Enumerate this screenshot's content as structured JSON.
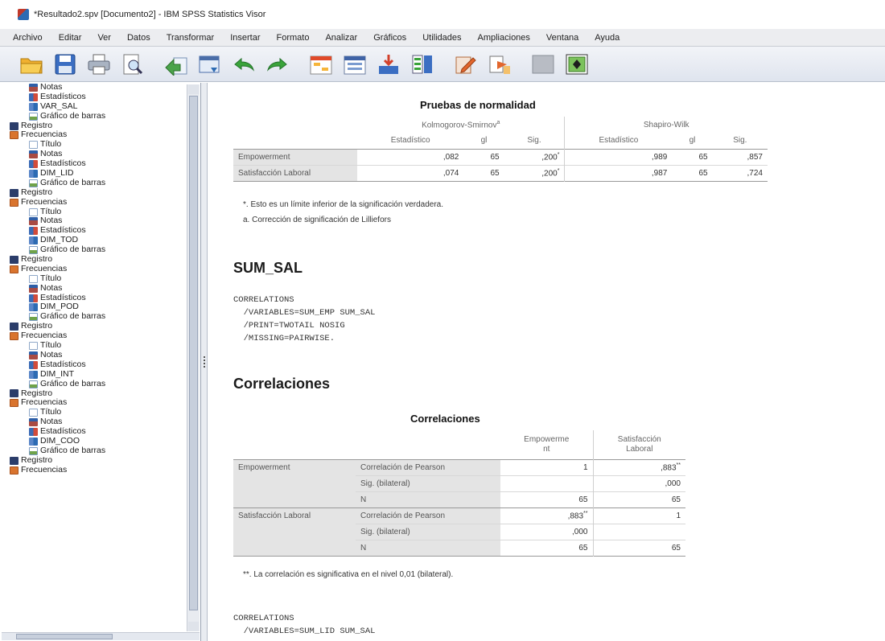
{
  "window": {
    "title": "*Resultado2.spv [Documento2] - IBM SPSS Statistics Visor"
  },
  "menu": [
    "Archivo",
    "Editar",
    "Ver",
    "Datos",
    "Transformar",
    "Insertar",
    "Formato",
    "Analizar",
    "Gráficos",
    "Utilidades",
    "Ampliaciones",
    "Ventana",
    "Ayuda"
  ],
  "toolbar": [
    "open-icon",
    "save-icon",
    "print-icon",
    "print-preview-icon",
    "export-icon",
    "recall-dialog-icon",
    "undo-icon",
    "redo-icon",
    "goto-data-icon",
    "goto-case-icon",
    "goto-variable-icon",
    "variables-icon",
    "show-all-icon",
    "hide-icon",
    "designated-window-icon",
    "insert-icon"
  ],
  "tree": [
    {
      "label": "Notas",
      "icon": "notes",
      "level": 1
    },
    {
      "label": "Estadísticos",
      "icon": "stats",
      "level": 1
    },
    {
      "label": "VAR_SAL",
      "icon": "var",
      "level": 1
    },
    {
      "label": "Gráfico de barras",
      "icon": "chart",
      "level": 1
    },
    {
      "label": "Registro",
      "icon": "log",
      "level": 0
    },
    {
      "label": "Frecuencias",
      "icon": "freq",
      "level": 0
    },
    {
      "label": "Título",
      "icon": "title",
      "level": 1
    },
    {
      "label": "Notas",
      "icon": "notes",
      "level": 1
    },
    {
      "label": "Estadísticos",
      "icon": "stats",
      "level": 1
    },
    {
      "label": "DIM_LID",
      "icon": "var",
      "level": 1
    },
    {
      "label": "Gráfico de barras",
      "icon": "chart",
      "level": 1
    },
    {
      "label": "Registro",
      "icon": "log",
      "level": 0
    },
    {
      "label": "Frecuencias",
      "icon": "freq",
      "level": 0
    },
    {
      "label": "Título",
      "icon": "title",
      "level": 1
    },
    {
      "label": "Notas",
      "icon": "notes",
      "level": 1
    },
    {
      "label": "Estadísticos",
      "icon": "stats",
      "level": 1
    },
    {
      "label": "DIM_TOD",
      "icon": "var",
      "level": 1
    },
    {
      "label": "Gráfico de barras",
      "icon": "chart",
      "level": 1
    },
    {
      "label": "Registro",
      "icon": "log",
      "level": 0
    },
    {
      "label": "Frecuencias",
      "icon": "freq",
      "level": 0
    },
    {
      "label": "Título",
      "icon": "title",
      "level": 1
    },
    {
      "label": "Notas",
      "icon": "notes",
      "level": 1
    },
    {
      "label": "Estadísticos",
      "icon": "stats",
      "level": 1
    },
    {
      "label": "DIM_POD",
      "icon": "var",
      "level": 1
    },
    {
      "label": "Gráfico de barras",
      "icon": "chart",
      "level": 1
    },
    {
      "label": "Registro",
      "icon": "log",
      "level": 0
    },
    {
      "label": "Frecuencias",
      "icon": "freq",
      "level": 0
    },
    {
      "label": "Título",
      "icon": "title",
      "level": 1
    },
    {
      "label": "Notas",
      "icon": "notes",
      "level": 1
    },
    {
      "label": "Estadísticos",
      "icon": "stats",
      "level": 1
    },
    {
      "label": "DIM_INT",
      "icon": "var",
      "level": 1
    },
    {
      "label": "Gráfico de barras",
      "icon": "chart",
      "level": 1
    },
    {
      "label": "Registro",
      "icon": "log",
      "level": 0
    },
    {
      "label": "Frecuencias",
      "icon": "freq",
      "level": 0
    },
    {
      "label": "Título",
      "icon": "title",
      "level": 1
    },
    {
      "label": "Notas",
      "icon": "notes",
      "level": 1
    },
    {
      "label": "Estadísticos",
      "icon": "stats",
      "level": 1
    },
    {
      "label": "DIM_COO",
      "icon": "var",
      "level": 1
    },
    {
      "label": "Gráfico de barras",
      "icon": "chart",
      "level": 1
    },
    {
      "label": "Registro",
      "icon": "log",
      "level": 0
    },
    {
      "label": "Frecuencias",
      "icon": "freq",
      "level": 0
    }
  ],
  "normality": {
    "title": "Pruebas de normalidad",
    "group_ks": "Kolmogorov-Smirnov",
    "group_ks_sup": "a",
    "group_sw": "Shapiro-Wilk",
    "cols": [
      "Estadístico",
      "gl",
      "Sig.",
      "Estadístico",
      "gl",
      "Sig."
    ],
    "rows": [
      {
        "label": "Empowerment",
        "ks_stat": ",082",
        "ks_gl": "65",
        "ks_sig": ",200",
        "ks_sig_sup": "*",
        "sw_stat": ",989",
        "sw_gl": "65",
        "sw_sig": ",857"
      },
      {
        "label": "Satisfacción Laboral",
        "ks_stat": ",074",
        "ks_gl": "65",
        "ks_sig": ",200",
        "ks_sig_sup": "*",
        "sw_stat": ",987",
        "sw_gl": "65",
        "sw_sig": ",724"
      }
    ],
    "footnotes": [
      "*. Esto es un límite inferior de la significación verdadera.",
      "a. Corrección de significación de Lilliefors"
    ]
  },
  "sum_sal_heading": "SUM_SAL",
  "syntax1": "CORRELATIONS\n  /VARIABLES=SUM_EMP SUM_SAL\n  /PRINT=TWOTAIL NOSIG\n  /MISSING=PAIRWISE.",
  "correlaciones_heading": "Correlaciones",
  "correlations": {
    "title": "Correlaciones",
    "col1": "Empowerme\nnt",
    "col2": "Satisfacción\nLaboral",
    "row1_label": "Empowerment",
    "row2_label": "Satisfacción Laboral",
    "stat_pearson": "Correlación de Pearson",
    "stat_sig": "Sig. (bilateral)",
    "stat_n": "N",
    "r1": {
      "pearson_1": "1",
      "pearson_2": ",883",
      "pearson_2_sup": "**",
      "sig_1": "",
      "sig_2": ",000",
      "n_1": "65",
      "n_2": "65"
    },
    "r2": {
      "pearson_1": ",883",
      "pearson_1_sup": "**",
      "pearson_2": "1",
      "sig_1": ",000",
      "sig_2": "",
      "n_1": "65",
      "n_2": "65"
    },
    "footnote": "**. La correlación es significativa en el nivel 0,01 (bilateral)."
  },
  "syntax2": "CORRELATIONS\n  /VARIABLES=SUM_LID SUM_SAL"
}
